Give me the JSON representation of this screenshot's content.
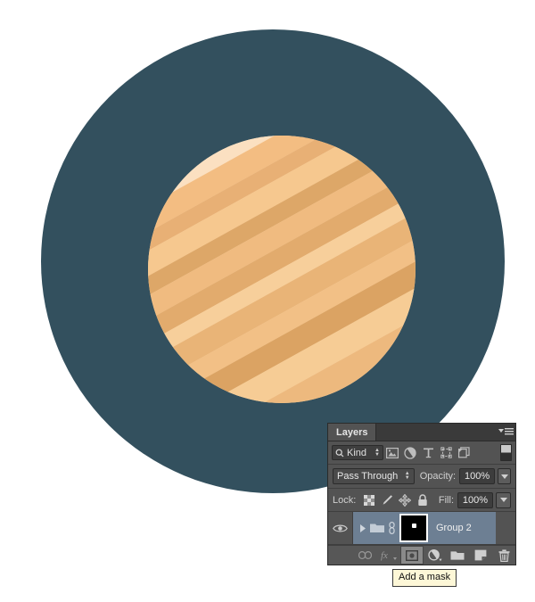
{
  "artwork": {
    "name": "planet-illustration",
    "background_circle_color": "#33505e",
    "planet_bands": [
      {
        "color": "#fbe3c8"
      },
      {
        "color": "#f7d0a4"
      },
      {
        "color": "#f5c48c"
      },
      {
        "color": "#fbe0c1"
      },
      {
        "color": "#f3bd82"
      },
      {
        "color": "#e8b075"
      },
      {
        "color": "#f6c88f"
      },
      {
        "color": "#dda768"
      },
      {
        "color": "#f0bb80"
      },
      {
        "color": "#e2ab6d"
      },
      {
        "color": "#f7cf9b"
      },
      {
        "color": "#e9b477"
      },
      {
        "color": "#f2c086"
      },
      {
        "color": "#dba363"
      },
      {
        "color": "#f6cc95"
      },
      {
        "color": "#edb97e"
      }
    ]
  },
  "panel": {
    "tab_label": "Layers",
    "menu_icon": "panel-menu-icon",
    "filter": {
      "search_icon": "search-icon",
      "kind_label": "Kind",
      "stepper_icon": "stepper-icon",
      "icons": [
        {
          "name": "pixel-layer-filter-icon",
          "title": "Filter for pixel layers"
        },
        {
          "name": "adjustment-layer-filter-icon",
          "title": "Filter for adjustment layers"
        },
        {
          "name": "type-layer-filter-icon",
          "title": "Filter for type layers"
        },
        {
          "name": "shape-layer-filter-icon",
          "title": "Filter for shape layers"
        },
        {
          "name": "smart-object-filter-icon",
          "title": "Filter for smart objects"
        }
      ],
      "toggle_name": "filter-toggle-switch"
    },
    "blend": {
      "mode": "Pass Through",
      "opacity_label": "Opacity:",
      "opacity_value": "100%"
    },
    "lock": {
      "label": "Lock:",
      "icons": [
        {
          "name": "lock-transparent-pixels-icon"
        },
        {
          "name": "lock-image-pixels-icon"
        },
        {
          "name": "lock-position-icon"
        },
        {
          "name": "lock-all-icon"
        }
      ],
      "fill_label": "Fill:",
      "fill_value": "100%"
    },
    "layers": [
      {
        "name": "Group 2",
        "visible": true,
        "eye_icon": "eye-icon",
        "expand_icon": "expand-triangle-icon",
        "folder_icon": "folder-icon",
        "link_icon": "link-mask-icon",
        "thumbnail": "layer-mask-thumbnail",
        "selected": true
      }
    ],
    "bottom_buttons": [
      {
        "name": "link-layers-button",
        "icon": "link-icon",
        "state": "dim"
      },
      {
        "name": "layer-style-button",
        "icon": "fx-icon",
        "state": "dim"
      },
      {
        "name": "add-mask-button",
        "icon": "add-mask-icon",
        "state": "active"
      },
      {
        "name": "new-adjustment-layer-button",
        "icon": "adjustment-icon",
        "state": "normal"
      },
      {
        "name": "new-group-button",
        "icon": "folder-icon",
        "state": "normal"
      },
      {
        "name": "new-layer-button",
        "icon": "new-layer-icon",
        "state": "normal"
      },
      {
        "name": "delete-layer-button",
        "icon": "trash-icon",
        "state": "normal"
      }
    ]
  },
  "tooltip": {
    "text": "Add a mask"
  },
  "colors": {
    "panel_bg": "#535353",
    "panel_tab_bg": "#3a3a3a",
    "layer_selected": "#6d7f93",
    "tooltip_bg": "#fdf7d7",
    "artwork_dark": "#33505e"
  }
}
